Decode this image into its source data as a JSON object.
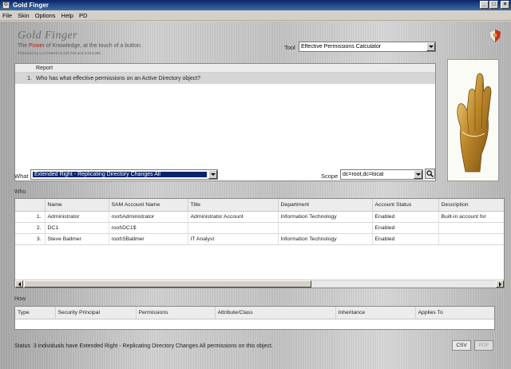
{
  "window": {
    "title": "Gold Finger",
    "app_icon": "G",
    "controls": [
      "_",
      "□",
      "×"
    ]
  },
  "menu": [
    "File",
    "Skin",
    "Options",
    "Help",
    "PD"
  ],
  "brand": {
    "name": "Gold Finger",
    "tagline_pre": "The ",
    "tagline_accent": "Power",
    "tagline_post": " of Knowledge, at the touch of a button.",
    "patent": "Protected by U.S Patents 8,429,708 and 8,843,996"
  },
  "tool": {
    "label": "Tool",
    "value": "Effective Permissions Calculator"
  },
  "report": {
    "header": "Report",
    "rows": [
      {
        "num": "1.",
        "text": "Who has what effective permissions on an Active Directory object?"
      }
    ]
  },
  "what": {
    "label": "What",
    "value": "Extended Right - Replicating Directory Changes All"
  },
  "scope": {
    "label": "Scope",
    "value": "dc=root,dc=local"
  },
  "who": {
    "label": "Who",
    "columns": [
      "",
      "Name",
      "SAM Account Name",
      "Title",
      "Department",
      "Account Status",
      "Description"
    ],
    "rows": [
      [
        "1.",
        "Administrator",
        "root\\Administrator",
        "Administrator Account",
        "Information Technology",
        "Enabled",
        "Built-in account for"
      ],
      [
        "2.",
        "DC1",
        "root\\DC1$",
        "",
        "",
        "Enabled",
        ""
      ],
      [
        "3.",
        "Steve Ballmer",
        "root\\SBallmer",
        "IT Analyst",
        "Information Technology",
        "Enabled",
        ""
      ]
    ]
  },
  "how": {
    "label": "How",
    "columns": [
      "Type",
      "Security Principal",
      "Permissions",
      "Attribute/Class",
      "Inheritance",
      "Applies To"
    ]
  },
  "status": {
    "label": "Status",
    "text": "3 individuals have Extended Right - Replicating Directory Changes All permissions on this object."
  },
  "buttons": {
    "csv": "CSV",
    "pdf": "PDF"
  },
  "colors": {
    "accent": "#b0261c",
    "titlebar": "#0a246a",
    "gold": "#c8a040"
  },
  "icons": [
    "shield-logo-icon",
    "search-icon",
    "golden-hand-image"
  ]
}
